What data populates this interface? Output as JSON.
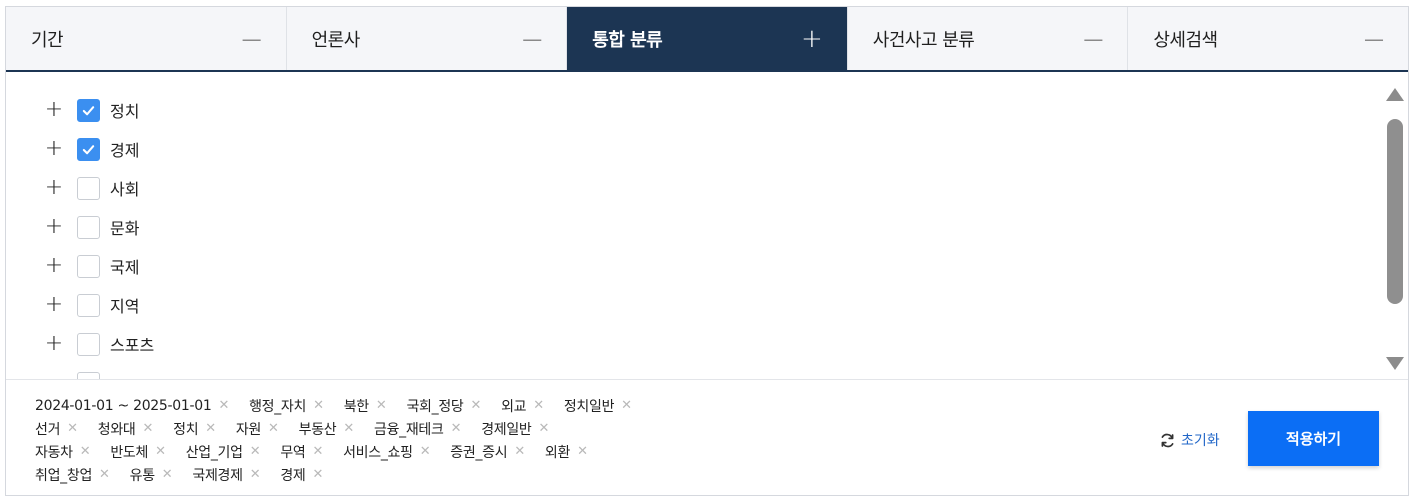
{
  "tabs": [
    {
      "label": "기간",
      "toggle": "—",
      "active": false
    },
    {
      "label": "언론사",
      "toggle": "—",
      "active": false
    },
    {
      "label": "통합 분류",
      "toggle": "+",
      "active": true
    },
    {
      "label": "사건사고 분류",
      "toggle": "—",
      "active": false
    },
    {
      "label": "상세검색",
      "toggle": "—",
      "active": false
    }
  ],
  "tree": {
    "expand_symbol": "+",
    "items": [
      {
        "label": "정치",
        "checked": true
      },
      {
        "label": "경제",
        "checked": true
      },
      {
        "label": "사회",
        "checked": false
      },
      {
        "label": "문화",
        "checked": false
      },
      {
        "label": "국제",
        "checked": false
      },
      {
        "label": "지역",
        "checked": false
      },
      {
        "label": "스포츠",
        "checked": false
      }
    ]
  },
  "filters": {
    "remove_symbol": "✕",
    "lines": [
      [
        "2024-01-01 ~ 2025-01-01",
        "행정_자치",
        "북한",
        "국회_정당",
        "외교",
        "정치일반"
      ],
      [
        "선거",
        "청와대",
        "정치",
        "자원",
        "부동산",
        "금융_재테크",
        "경제일반"
      ],
      [
        "자동차",
        "반도체",
        "산업_기업",
        "무역",
        "서비스_쇼핑",
        "증권_증시",
        "외환"
      ],
      [
        "취업_창업",
        "유통",
        "국제경제",
        "경제"
      ]
    ]
  },
  "actions": {
    "reset_label": "초기화",
    "reset_icon": "refresh-icon",
    "apply_label": "적용하기"
  },
  "colors": {
    "active_tab": "#1c3553",
    "checkbox_checked": "#3b8ff0",
    "apply_button": "#0b6ef5",
    "reset_text": "#2267c8"
  }
}
